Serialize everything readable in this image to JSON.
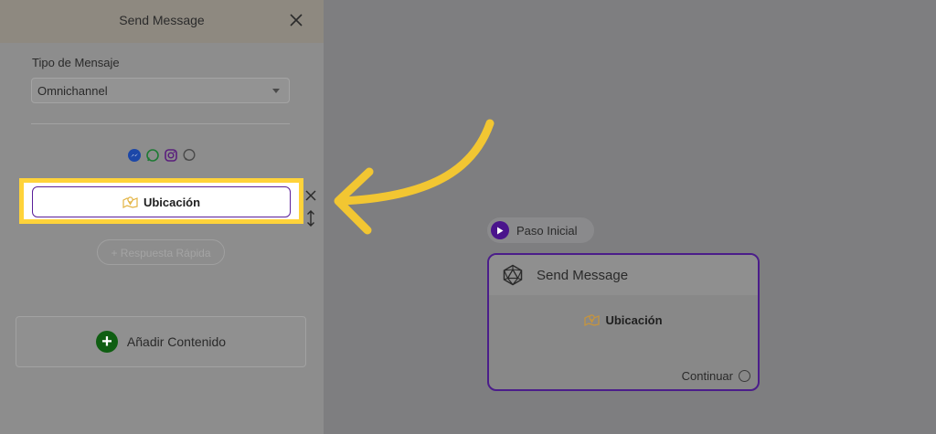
{
  "panel": {
    "title": "Send Message",
    "message_type_label": "Tipo de Mensaje",
    "message_type_value": "Omnichannel",
    "channel_icons": [
      "messenger-icon",
      "whatsapp-icon",
      "instagram-icon",
      "chat-icon"
    ],
    "location_item_label": "Ubicación",
    "quick_reply_label": "+ Respuesta Rápida",
    "add_content_label": "Añadir Contenido"
  },
  "canvas": {
    "start_label": "Paso Inicial",
    "node_title": "Send Message",
    "node_content_label": "Ubicación",
    "continue_label": "Continuar"
  },
  "colors": {
    "highlight": "#ffd33a",
    "accent_purple": "#4b1d8a",
    "add_green": "#0f5e12"
  }
}
